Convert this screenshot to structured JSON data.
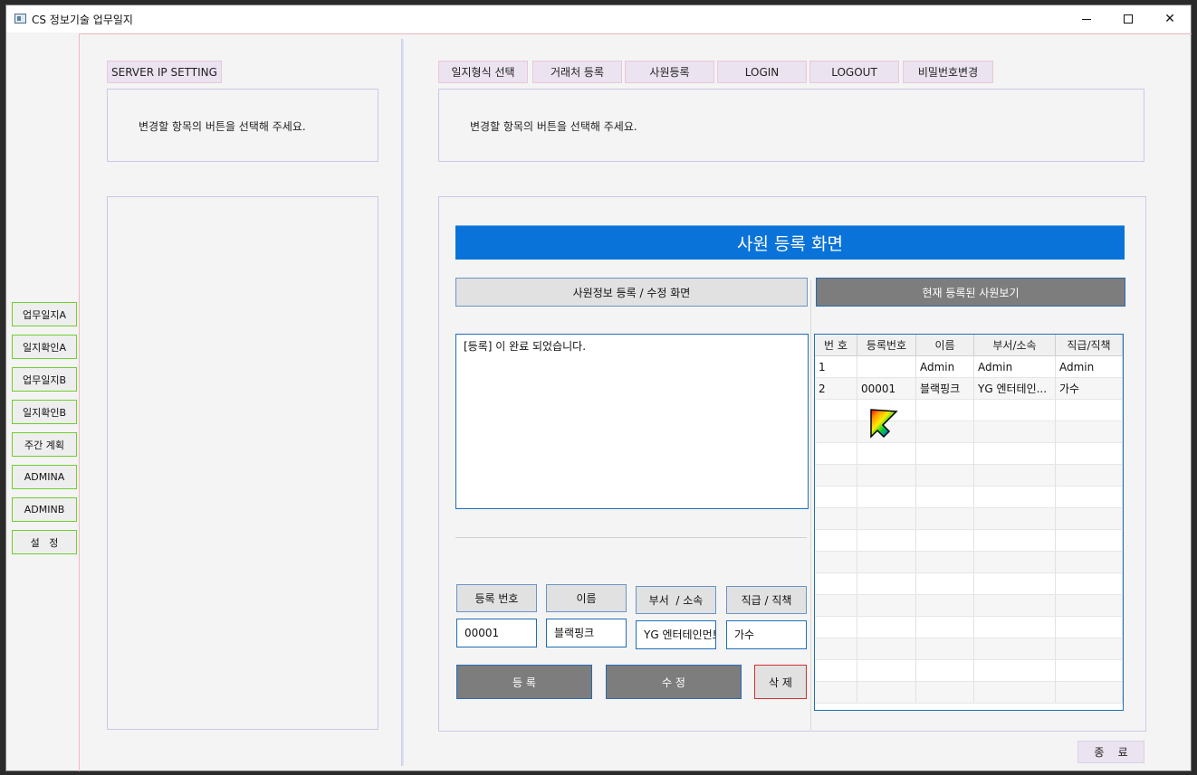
{
  "window": {
    "title": "CS 정보기술 업무일지"
  },
  "sidebar": {
    "items": [
      {
        "label": "업무일지A"
      },
      {
        "label": "일지확인A"
      },
      {
        "label": "업무일지B"
      },
      {
        "label": "일지확인B"
      },
      {
        "label": "주간 계획"
      },
      {
        "label": "ADMINA"
      },
      {
        "label": "ADMINB"
      },
      {
        "label": "설   정"
      }
    ]
  },
  "left_panel": {
    "server_button": "SERVER IP SETTING",
    "hint": "변경할 항목의 버튼을 선택해 주세요."
  },
  "top_menu": {
    "items": [
      {
        "label": "일지형식 선택"
      },
      {
        "label": "거래처 등록"
      },
      {
        "label": "사원등록"
      },
      {
        "label": "LOGIN"
      },
      {
        "label": "LOGOUT"
      },
      {
        "label": "비밀번호변경"
      }
    ],
    "hint": "변경할 항목의 버튼을 선택해 주세요."
  },
  "employee": {
    "banner": "사원 등록 화면",
    "edit_tab": "사원정보 등록 / 수정 화면",
    "view_tab": "현재 등록된 사원보기",
    "message": "[등록] 이 완료 되었습니다.",
    "labels": {
      "reg_no": "등록 번호",
      "name": "이름",
      "dept": "부서  / 소속",
      "position": "직급 / 직책"
    },
    "values": {
      "reg_no": "00001",
      "name": "블랙핑크",
      "dept": "YG 엔터테인먼트",
      "position": "가수"
    },
    "actions": {
      "register": "등 록",
      "modify": "수 정",
      "delete": "삭 제"
    }
  },
  "grid": {
    "columns": [
      "번 호",
      "등록번호",
      "이름",
      "부서/소속",
      "직급/직책"
    ],
    "rows": [
      [
        "1",
        "",
        "Admin",
        "Admin",
        "Admin"
      ],
      [
        "2",
        "00001",
        "블랙핑크",
        "YG 엔터테인...",
        "가수"
      ]
    ]
  },
  "footer": {
    "exit": "종    료"
  },
  "colors": {
    "banner": "#0a73d9",
    "sidebar_border": "#6fcf2f",
    "delete_border": "#d32f2f"
  }
}
